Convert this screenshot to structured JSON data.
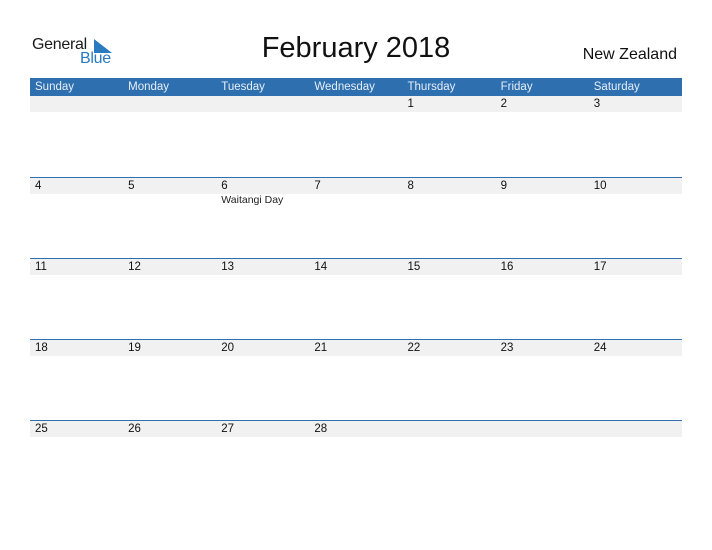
{
  "logo": {
    "general": "General",
    "blue": "Blue"
  },
  "title": "February 2018",
  "country": "New Zealand",
  "day_names": [
    "Sunday",
    "Monday",
    "Tuesday",
    "Wednesday",
    "Thursday",
    "Friday",
    "Saturday"
  ],
  "weeks": [
    [
      {
        "d": ""
      },
      {
        "d": ""
      },
      {
        "d": ""
      },
      {
        "d": ""
      },
      {
        "d": "1"
      },
      {
        "d": "2"
      },
      {
        "d": "3"
      }
    ],
    [
      {
        "d": "4"
      },
      {
        "d": "5"
      },
      {
        "d": "6",
        "h": "Waitangi Day"
      },
      {
        "d": "7"
      },
      {
        "d": "8"
      },
      {
        "d": "9"
      },
      {
        "d": "10"
      }
    ],
    [
      {
        "d": "11"
      },
      {
        "d": "12"
      },
      {
        "d": "13"
      },
      {
        "d": "14"
      },
      {
        "d": "15"
      },
      {
        "d": "16"
      },
      {
        "d": "17"
      }
    ],
    [
      {
        "d": "18"
      },
      {
        "d": "19"
      },
      {
        "d": "20"
      },
      {
        "d": "21"
      },
      {
        "d": "22"
      },
      {
        "d": "23"
      },
      {
        "d": "24"
      }
    ],
    [
      {
        "d": "25"
      },
      {
        "d": "26"
      },
      {
        "d": "27"
      },
      {
        "d": "28"
      },
      {
        "d": ""
      },
      {
        "d": ""
      },
      {
        "d": ""
      }
    ]
  ],
  "colors": {
    "header_bg": "#2e6fb0",
    "brand_blue": "#2a7abf",
    "date_strip": "#f1f1f1"
  }
}
